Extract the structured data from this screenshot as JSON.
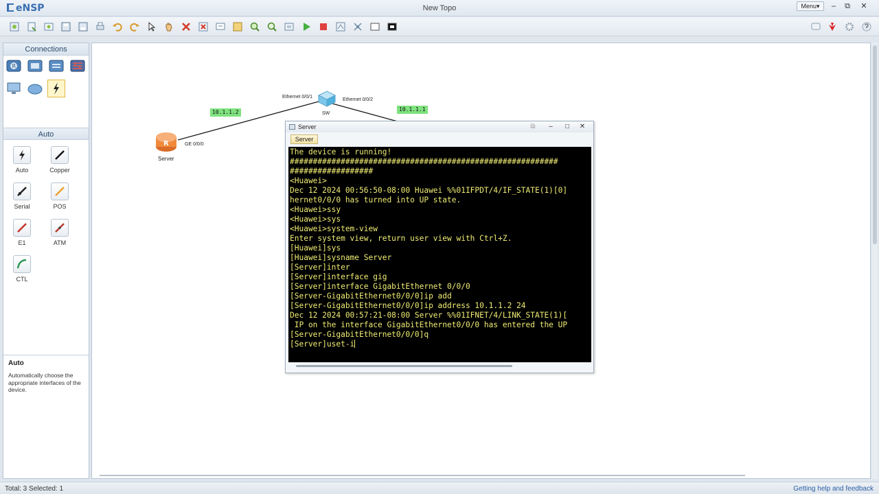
{
  "app": {
    "name": "eNSP",
    "window_title": "New Topo",
    "menu_label": "Menu▾",
    "window_controls": [
      "–",
      "⧉",
      "✕"
    ]
  },
  "toolbar": {
    "icons": [
      "new-topo-icon",
      "new-lab-icon",
      "open-icon",
      "save-icon",
      "save-as-icon",
      "print-icon",
      "undo-icon",
      "redo-icon",
      "select-icon",
      "pan-icon",
      "delete-icon",
      "delete-all-icon",
      "text-icon",
      "palette-icon",
      "zoom-in-icon",
      "zoom-out-icon",
      "fit-icon",
      "start-icon",
      "stop-icon",
      "capture-icon",
      "topology-icon",
      "grid-icon",
      "terminal-icon"
    ],
    "right_icons": [
      "chat-icon",
      "huawei-icon",
      "settings-icon",
      "help-icon"
    ]
  },
  "left_panel": {
    "connections_header": "Connections",
    "device_icons": [
      "router-icon",
      "switch-icon",
      "wlan-icon",
      "firewall-icon",
      "pc-icon",
      "cloud-icon",
      "connection-icon"
    ],
    "auto_header": "Auto",
    "tools": [
      {
        "label": "Auto",
        "color": "#222222"
      },
      {
        "label": "Copper",
        "color": "#111111"
      },
      {
        "label": "Serial",
        "color": "#222222"
      },
      {
        "label": "POS",
        "color": "#e8a030"
      },
      {
        "label": "E1",
        "color": "#c8322a"
      },
      {
        "label": "ATM",
        "color": "#b83a2a"
      },
      {
        "label": "CTL",
        "color": "#2f9a58"
      }
    ],
    "help_title": "Auto",
    "help_text": "Automatically choose the appropriate interfaces of the device."
  },
  "topology": {
    "router": {
      "name": "Server",
      "port": "GE 0/0/0"
    },
    "switch": {
      "name": "SW",
      "port_left": "Ethernet 0/0/1",
      "port_right": "Ethernet 0/0/2"
    },
    "ip_left": "10.1.1.2",
    "ip_right": "10.1.1.1"
  },
  "terminal": {
    "title": "Server",
    "tab": "Server",
    "lines": [
      "The device is running!",
      "##########################################################",
      "##################",
      "<Huawei>",
      "Dec 12 2024 00:56:50-08:00 Huawei %%01IFPDT/4/IF_STATE(1)[0]",
      "hernet0/0/0 has turned into UP state.",
      "<Huawei>ssy",
      "<Huawei>sys",
      "<Huawei>system-view",
      "Enter system view, return user view with Ctrl+Z.",
      "[Huawei]sys",
      "[Huawei]sysname Server",
      "[Server]inter",
      "[Server]interface gig",
      "[Server]interface GigabitEthernet 0/0/0",
      "[Server-GigabitEthernet0/0/0]ip add",
      "[Server-GigabitEthernet0/0/0]ip address 10.1.1.2 24",
      "Dec 12 2024 00:57:21-08:00 Server %%01IFNET/4/LINK_STATE(1)[",
      " IP on the interface GigabitEthernet0/0/0 has entered the UP",
      "[Server-GigabitEthernet0/0/0]q",
      "[Server]uset-i"
    ]
  },
  "status": {
    "left": "Total: 3  Selected: 1",
    "right": "Getting help and feedback"
  }
}
